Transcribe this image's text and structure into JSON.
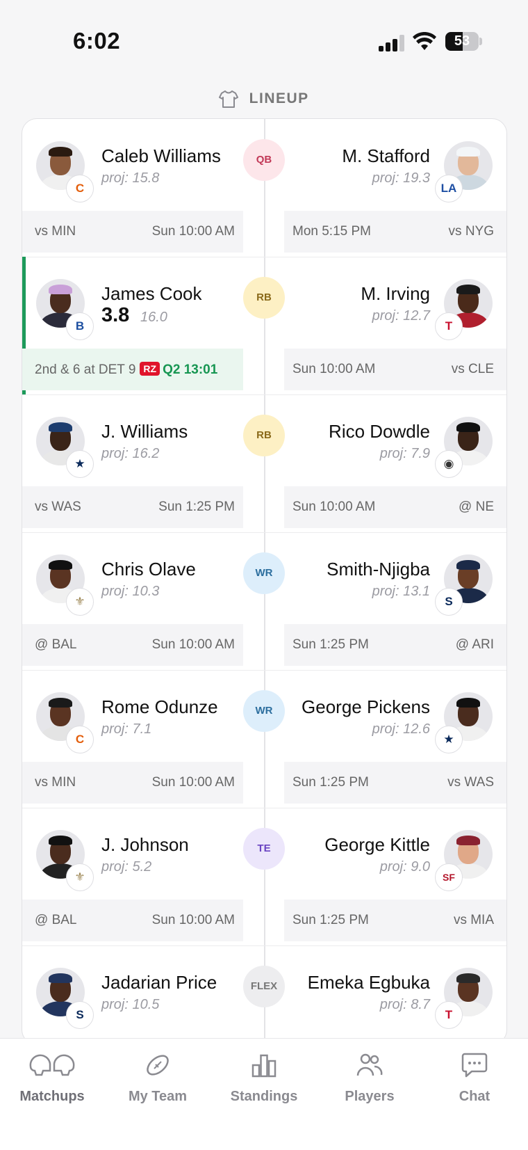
{
  "status_bar": {
    "time": "6:02",
    "battery_label": "53",
    "battery_level": 0.53
  },
  "header": {
    "title": "LINEUP",
    "icon": "shirt-icon"
  },
  "colors": {
    "live_accent": "#1d9a5a",
    "rz_badge": "#e0142b"
  },
  "positions": {
    "qb": "QB",
    "rb": "RB",
    "wr": "WR",
    "te": "TE",
    "flex": "FLEX"
  },
  "rows": [
    {
      "left": {
        "name": "Caleb Williams",
        "proj": "proj: 15.8",
        "team_icon": "bears-logo-icon",
        "info_a": "vs MIN",
        "info_b": "Sun 10:00 AM"
      },
      "right": {
        "name": "M. Stafford",
        "proj": "proj: 19.3",
        "team_icon": "rams-logo-icon",
        "info_a": "Mon 5:15 PM",
        "info_b": "vs NYG"
      }
    },
    {
      "left": {
        "name": "James Cook",
        "score": "3.8",
        "proj": "16.0",
        "team_icon": "bills-logo-icon",
        "down_text": "2nd & 6 at DET 9",
        "rz": "RZ",
        "clock": "Q2 13:01"
      },
      "right": {
        "name": "M. Irving",
        "proj": "proj: 12.7",
        "team_icon": "buccaneers-logo-icon",
        "info_a": "Sun 10:00 AM",
        "info_b": "vs CLE"
      }
    },
    {
      "left": {
        "name": "J. Williams",
        "proj": "proj: 16.2",
        "team_icon": "cowboys-logo-icon",
        "info_a": "vs WAS",
        "info_b": "Sun 1:25 PM"
      },
      "right": {
        "name": "Rico Dowdle",
        "proj": "proj: 7.9",
        "team_icon": "steelers-logo-icon",
        "info_a": "Sun 10:00 AM",
        "info_b": "@ NE"
      }
    },
    {
      "left": {
        "name": "Chris Olave",
        "proj": "proj: 10.3",
        "team_icon": "saints-logo-icon",
        "info_a": "@ BAL",
        "info_b": "Sun 10:00 AM"
      },
      "right": {
        "name": "Smith-Njigba",
        "proj": "proj: 13.1",
        "team_icon": "seahawks-logo-icon",
        "info_a": "Sun 1:25 PM",
        "info_b": "@ ARI"
      }
    },
    {
      "left": {
        "name": "Rome Odunze",
        "proj": "proj: 7.1",
        "team_icon": "bears-logo-icon",
        "info_a": "vs MIN",
        "info_b": "Sun 10:00 AM"
      },
      "right": {
        "name": "George Pickens",
        "proj": "proj: 12.6",
        "team_icon": "cowboys-logo-icon",
        "info_a": "Sun 1:25 PM",
        "info_b": "vs WAS"
      }
    },
    {
      "left": {
        "name": "J. Johnson",
        "proj": "proj: 5.2",
        "team_icon": "saints-logo-icon",
        "info_a": "@ BAL",
        "info_b": "Sun 10:00 AM"
      },
      "right": {
        "name": "George Kittle",
        "proj": "proj: 9.0",
        "team_icon": "49ers-logo-icon",
        "info_a": "Sun 1:25 PM",
        "info_b": "vs MIA"
      }
    },
    {
      "left": {
        "name": "Jadarian Price",
        "proj": "proj: 10.5",
        "team_icon": "seahawks-logo-icon"
      },
      "right": {
        "name": "Emeka Egbuka",
        "proj": "proj: 8.7",
        "team_icon": "buccaneers-logo-icon"
      }
    }
  ],
  "tabs": [
    {
      "label": "Matchups",
      "icon": "helmets-icon"
    },
    {
      "label": "My Team",
      "icon": "football-icon"
    },
    {
      "label": "Standings",
      "icon": "bar-chart-icon"
    },
    {
      "label": "Players",
      "icon": "people-icon"
    },
    {
      "label": "Chat",
      "icon": "chat-bubble-icon"
    }
  ]
}
